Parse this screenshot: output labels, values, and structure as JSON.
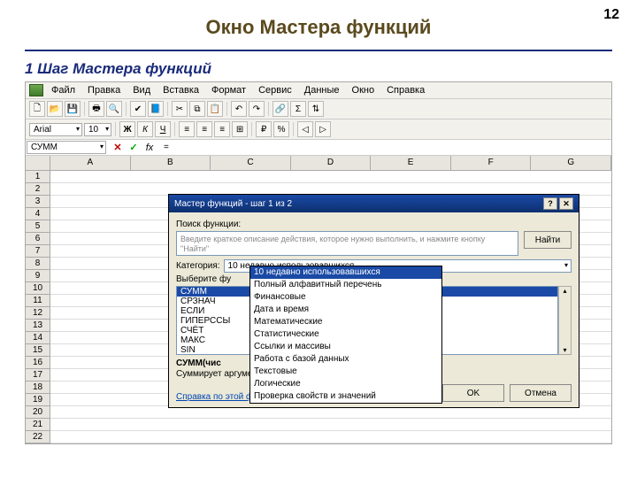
{
  "slide": {
    "number": "12",
    "title": "Окно Мастера функций",
    "subtitle": "1 Шаг Мастера функций"
  },
  "menubar": [
    "Файл",
    "Правка",
    "Вид",
    "Вставка",
    "Формат",
    "Сервис",
    "Данные",
    "Окно",
    "Справка"
  ],
  "font": {
    "name": "Arial",
    "size": "10"
  },
  "formula": {
    "namebox": "СУММ",
    "value": "="
  },
  "columns": [
    "A",
    "B",
    "C",
    "D",
    "E",
    "F",
    "G"
  ],
  "rows": [
    "1",
    "2",
    "3",
    "4",
    "5",
    "6",
    "7",
    "8",
    "9",
    "10",
    "11",
    "12",
    "13",
    "14",
    "15",
    "16",
    "17",
    "18",
    "19",
    "20",
    "21",
    "22"
  ],
  "wizard": {
    "title": "Мастер функций - шаг 1 из 2",
    "search_label": "Поиск функции:",
    "search_placeholder": "Введите краткое описание действия, которое нужно выполнить, и нажмите кнопку \"Найти\"",
    "find_label": "Найти",
    "category_label": "Категория:",
    "category_value": "10 недавно использовавшихся",
    "select_label": "Выберите фу",
    "functions": [
      "СУММ",
      "СРЗНАЧ",
      "ЕСЛИ",
      "ГИПЕРССЫ",
      "СЧЁТ",
      "МАКС",
      "SIN"
    ],
    "signature": "СУММ(чис",
    "description": "Суммирует аргументы.",
    "help_link": "Справка по этой функции",
    "ok": "OK",
    "cancel": "Отмена"
  },
  "categories": [
    "10 недавно использовавшихся",
    "Полный алфавитный перечень",
    "Финансовые",
    "Дата и время",
    "Математические",
    "Статистические",
    "Ссылки и массивы",
    "Работа с базой данных",
    "Текстовые",
    "Логические",
    "Проверка свойств и значений"
  ]
}
